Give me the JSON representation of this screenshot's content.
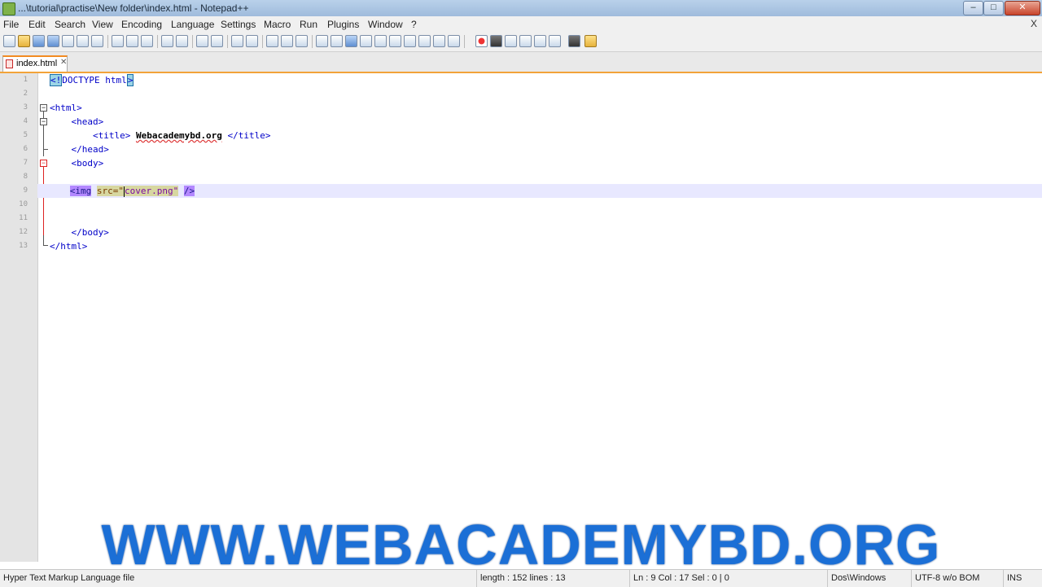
{
  "window": {
    "title": "...\\tutorial\\practise\\New folder\\index.html - Notepad++",
    "minimize": "–",
    "maximize": "□",
    "close": "✕"
  },
  "menu": {
    "items": [
      "File",
      "Edit",
      "Search",
      "View",
      "Encoding",
      "Language",
      "Settings",
      "Macro",
      "Run",
      "Plugins",
      "Window",
      "?"
    ],
    "close_document": "X"
  },
  "toolbar": {
    "icons": [
      "new-file-icon",
      "open-file-icon",
      "save-icon",
      "save-all-icon",
      "close-icon",
      "close-all-icon",
      "print-icon",
      "cut-icon",
      "copy-icon",
      "paste-icon",
      "undo-icon",
      "redo-icon",
      "find-icon",
      "replace-icon",
      "zoom-in-icon",
      "zoom-out-icon",
      "sync-vertical-icon",
      "sync-horizontal-icon",
      "word-wrap-icon",
      "show-all-chars-icon",
      "indent-guide-icon",
      "user-language-icon",
      "doc-map-icon",
      "function-list-icon",
      "record-macro-icon",
      "stop-record-icon",
      "play-macro-icon",
      "run-macro-multiple-icon",
      "save-macro-icon",
      "monitoring-icon",
      "folder-as-workspace-icon"
    ]
  },
  "tab": {
    "label": "index.html",
    "close": "✕"
  },
  "editor": {
    "line_numbers": [
      "1",
      "2",
      "3",
      "4",
      "5",
      "6",
      "7",
      "8",
      "9",
      "10",
      "11",
      "12",
      "13"
    ],
    "lines": {
      "l1_open": "<!",
      "l1_mid": "DOCTYPE html",
      "l1_close": ">",
      "l3": "<html>",
      "l4": "    <head>",
      "l5_indent": "        ",
      "l5_open": "<title> ",
      "l5_text": "Webacademybd.org",
      "l5_close": " </title>",
      "l6": "    </head>",
      "l7": "    <body>",
      "l9_indent": "    ",
      "l9_tag": "<img",
      "l9_attr": "src=\"",
      "l9_str": "cover.png\"",
      "l9_end": "/>",
      "l12": "    </body>",
      "l13": "</html>"
    }
  },
  "watermark": "WWW.WEBACADEMYBD.ORG",
  "status": {
    "file_type": "Hyper Text Markup Language file",
    "length": "length : 152    lines : 13",
    "position": "Ln : 9    Col : 17    Sel : 0 | 0",
    "eol": "Dos\\Windows",
    "encoding": "UTF-8 w/o BOM",
    "mode": "INS"
  }
}
